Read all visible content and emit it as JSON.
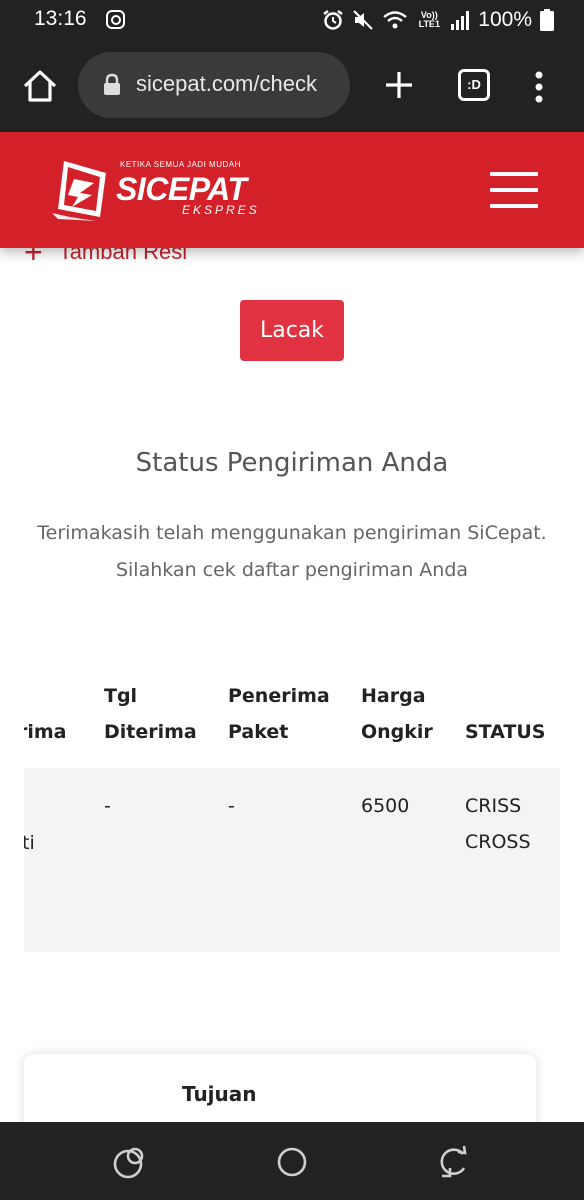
{
  "status_bar": {
    "time": "13:16",
    "network_label": "Vo)) LTE1",
    "battery": "100%",
    "icons": [
      "instagram-icon",
      "alarm-icon",
      "mute-icon",
      "wifi-icon",
      "signal-icon",
      "battery-icon"
    ]
  },
  "browser": {
    "url": "sicepat.com/check",
    "tabs_label": ":D"
  },
  "header": {
    "logo_tagline": "KETIKA SEMUA JADI MUDAH",
    "logo_name": "SICEPAT",
    "logo_sub": "EKSPRES",
    "brand_color": "#d42129"
  },
  "form": {
    "add_resi_label": "Tambah Resi",
    "track_button": "Lacak"
  },
  "status": {
    "title": "Status Pengiriman Anda",
    "line1": "Terimakasih telah menggunakan pengiriman SiCepat.",
    "line2": "Silahkan cek daftar pengiriman Anda"
  },
  "table": {
    "headers": {
      "partial_col": "rima",
      "tgl_diterima_1": "Tgl",
      "tgl_diterima_2": "Diterima",
      "penerima_1": "Penerima",
      "penerima_2": "Paket",
      "harga_1": "Harga",
      "harga_2": "Ongkir",
      "status": "STATUS"
    },
    "row": {
      "partial_cell": "ti",
      "tgl_diterima": "-",
      "penerima": "-",
      "harga": "6500",
      "status_1": "CRISS",
      "status_2": "CROSS"
    }
  },
  "card": {
    "title": "Tujuan"
  }
}
